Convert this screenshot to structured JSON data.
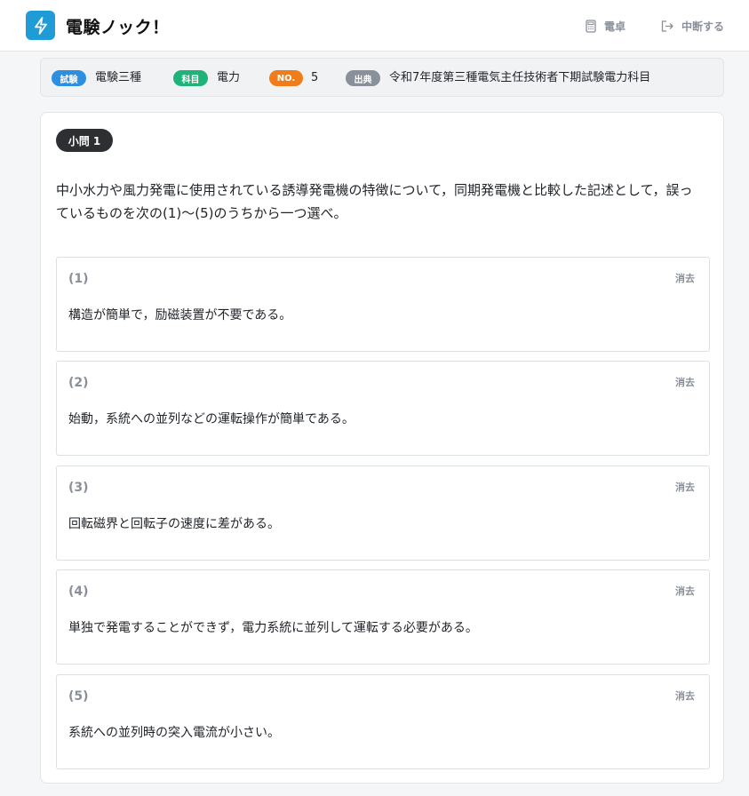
{
  "app": {
    "title": "電験ノック！",
    "brand_color": "#1f9bd6",
    "logo_icon": "lightning-bolt-icon"
  },
  "header": {
    "calculator_label": "電卓",
    "calculator_icon": "calculator-icon",
    "quit_label": "中断する",
    "quit_icon": "exit-icon"
  },
  "info": {
    "exam": {
      "badge": "試験",
      "value": "電験三種",
      "color": "#2d8fe0"
    },
    "subject": {
      "badge": "科目",
      "value": "電力",
      "color": "#1fb37a"
    },
    "number": {
      "badge": "NO.",
      "value": "5",
      "color": "#f07d1a"
    },
    "source": {
      "badge": "出典",
      "value": "令和7年度第三種電気主任技術者下期試験電力科目",
      "color": "#8a9099"
    }
  },
  "question": {
    "label": "小問 1",
    "text": "中小水力や風力発電に使用されている誘導発電機の特徴について，同期発電機と比較した記述として，誤っているものを次の(1)〜(5)のうちから一つ選べ。"
  },
  "options": [
    {
      "num": "(1)",
      "text": "構造が簡単で，励磁装置が不要である。",
      "clear_label": "消去"
    },
    {
      "num": "(2)",
      "text": "始動，系統への並列などの運転操作が簡単である。",
      "clear_label": "消去"
    },
    {
      "num": "(3)",
      "text": "回転磁界と回転子の速度に差がある。",
      "clear_label": "消去"
    },
    {
      "num": "(4)",
      "text": "単独で発電することができず，電力系統に並列して運転する必要がある。",
      "clear_label": "消去"
    },
    {
      "num": "(5)",
      "text": "系統への並列時の突入電流が小さい。",
      "clear_label": "消去"
    }
  ]
}
